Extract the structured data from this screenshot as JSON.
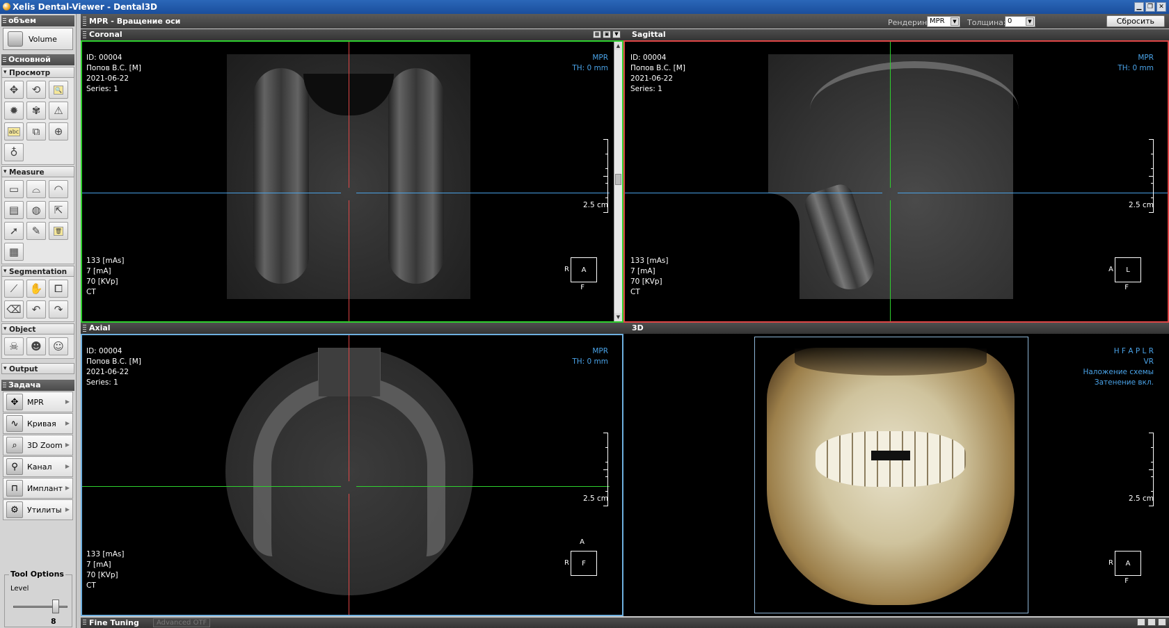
{
  "window": {
    "title": "Xelis Dental-Viewer - Dental3D"
  },
  "left_panel": {
    "volume_section": "объем",
    "volume_button": "Volume",
    "main_section": "Основной",
    "view_group": "Просмотр",
    "view_tools": [
      {
        "name": "pan-icon",
        "glyph": "✥"
      },
      {
        "name": "rotate-icon",
        "glyph": "⟲"
      },
      {
        "name": "zoom-icon",
        "glyph": "🔍"
      },
      {
        "name": "brightness-icon",
        "glyph": "✹"
      },
      {
        "name": "fan-icon",
        "glyph": "✾"
      },
      {
        "name": "warning-icon",
        "glyph": "⚠"
      },
      {
        "name": "annotation-text-icon",
        "glyph": "abc"
      },
      {
        "name": "copy-icon",
        "glyph": "⧉"
      },
      {
        "name": "crosshair-icon",
        "glyph": "⊕"
      },
      {
        "name": "tooth-icon",
        "glyph": "♁"
      }
    ],
    "measure_group": "Measure",
    "measure_tools": [
      {
        "name": "ruler-icon",
        "glyph": "▭"
      },
      {
        "name": "area-icon",
        "glyph": "⌓"
      },
      {
        "name": "angle-icon",
        "glyph": "◠"
      },
      {
        "name": "profile-icon",
        "glyph": "▤"
      },
      {
        "name": "sphere-icon",
        "glyph": "◍"
      },
      {
        "name": "label-arrow-icon",
        "glyph": "⇱"
      },
      {
        "name": "select-pointer-icon",
        "glyph": "➚"
      },
      {
        "name": "edit-pencil-icon",
        "glyph": "✎"
      },
      {
        "name": "delete-trash-icon",
        "glyph": "🗑"
      },
      {
        "name": "delete-all-icon",
        "glyph": "▦"
      }
    ],
    "segmentation_group": "Segmentation",
    "segmentation_tools": [
      {
        "name": "cut-knife-icon",
        "glyph": "⟋"
      },
      {
        "name": "sculpt-hand-icon",
        "glyph": "✋"
      },
      {
        "name": "region-icon",
        "glyph": "⧠"
      },
      {
        "name": "eraser-icon",
        "glyph": "⌫"
      },
      {
        "name": "undo-icon",
        "glyph": "↶"
      },
      {
        "name": "redo-icon",
        "glyph": "↷"
      }
    ],
    "object_group": "Object",
    "object_tools": [
      {
        "name": "skull-icon",
        "glyph": "☠"
      },
      {
        "name": "head-side-icon",
        "glyph": "☻"
      },
      {
        "name": "head-face-icon",
        "glyph": "☺"
      }
    ],
    "output_group": "Output",
    "task_section": "Задача",
    "tasks": [
      {
        "label": "MPR",
        "glyph": "✥"
      },
      {
        "label": "Кривая",
        "glyph": "∿"
      },
      {
        "label": "3D Zoom",
        "glyph": "⌕"
      },
      {
        "label": "Канал",
        "glyph": "⚲"
      },
      {
        "label": "Имплант",
        "glyph": "⊓"
      },
      {
        "label": "Утилиты",
        "glyph": "⚙"
      }
    ],
    "tool_options": {
      "title": "Tool Options",
      "level_label": "Level",
      "level_value": "8"
    }
  },
  "toolbar": {
    "title": "MPR - Вращение оси",
    "render_label": "Рендеринг:",
    "render_value": "MPR",
    "thickness_label": "Толщина:",
    "thickness_value": "0",
    "reset_label": "Сбросить"
  },
  "patient": {
    "id": "ID: 00004",
    "name": "Попов В.С. [M]",
    "date": "2021-06-22",
    "series": "Series: 1",
    "mas": "133 [mAs]",
    "ma": "7 [mA]",
    "kvp": "70 [KVp]",
    "modality": "CT"
  },
  "viewports": {
    "coronal": {
      "title": "Coronal",
      "mode": "MPR",
      "th": "TH: 0 mm",
      "scale": "2.5 cm",
      "orient_left": "R",
      "orient_box": "A",
      "orient_bottom": "F",
      "color": "#2fd12f"
    },
    "sagittal": {
      "title": "Sagittal",
      "mode": "MPR",
      "th": "TH: 0 mm",
      "scale": "2.5 cm",
      "orient_left": "A",
      "orient_box": "L",
      "orient_bottom": "F",
      "color": "#e04646"
    },
    "axial": {
      "title": "Axial",
      "mode": "MPR",
      "th": "TH: 0 mm",
      "scale": "2.5 cm",
      "orient_top": "A",
      "orient_left": "R",
      "orient_box": "F",
      "color": "#6fb0e0"
    },
    "3d": {
      "title": "3D",
      "line1": "H F A P L R",
      "line2": "VR",
      "line3": "Наложение схемы",
      "line4": "Затенение вкл.",
      "scale": "2.5 cm",
      "orient_left": "R",
      "orient_box": "A",
      "orient_bottom": "F"
    }
  },
  "bottom_bar": {
    "title": "Fine Tuning",
    "tab": "Advanced OTF"
  }
}
